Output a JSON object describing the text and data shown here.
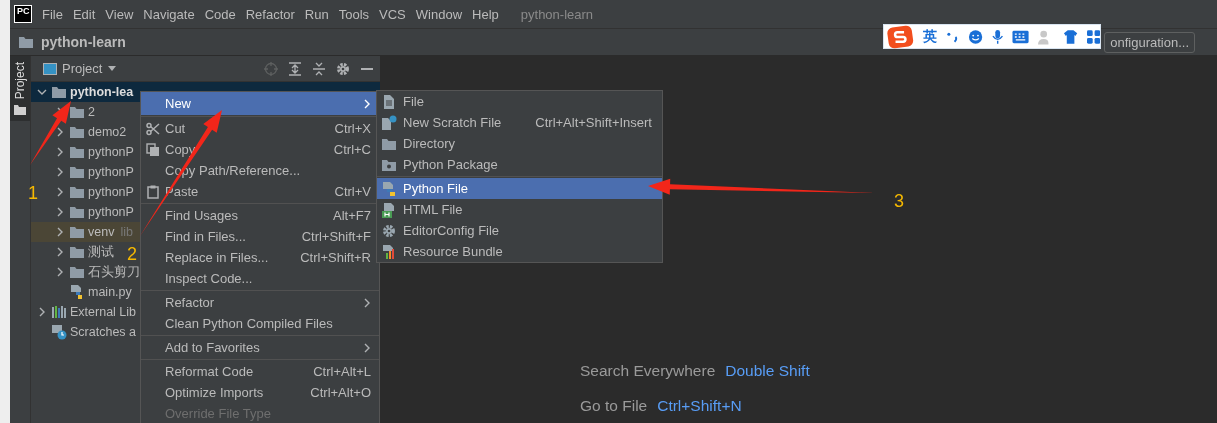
{
  "menu_bar": {
    "logo": "PC",
    "items": [
      "File",
      "Edit",
      "View",
      "Navigate",
      "Code",
      "Refactor",
      "Run",
      "Tools",
      "VCS",
      "Window",
      "Help"
    ],
    "project_title": "python-learn"
  },
  "nav_bar": {
    "project": "python-learn",
    "run_config": "onfiguration..."
  },
  "tool_window_stripe": {
    "label": "Project"
  },
  "project_panel": {
    "title": "Project",
    "tree": [
      {
        "label": "python-lea",
        "kind": "folder",
        "expanded": true,
        "selected": true,
        "highlighted": false,
        "children": [
          {
            "label": "2",
            "kind": "folder",
            "expanded": false,
            "selected": false,
            "highlighted": false
          },
          {
            "label": "demo2",
            "kind": "folder",
            "expanded": false,
            "selected": false,
            "highlighted": false
          },
          {
            "label": "pythonP",
            "kind": "folder",
            "expanded": false,
            "selected": false,
            "highlighted": false
          },
          {
            "label": "pythonP",
            "kind": "folder",
            "expanded": false,
            "selected": false,
            "highlighted": false
          },
          {
            "label": "pythonP",
            "kind": "folder",
            "expanded": false,
            "selected": false,
            "highlighted": false
          },
          {
            "label": "pythonP",
            "kind": "folder",
            "expanded": false,
            "selected": false,
            "highlighted": false
          },
          {
            "label": "venv",
            "hint": "lib",
            "kind": "folder",
            "expanded": false,
            "selected": false,
            "highlighted": true
          },
          {
            "label": "测试",
            "kind": "folder",
            "expanded": false,
            "selected": false,
            "highlighted": false
          },
          {
            "label": "石头剪刀",
            "kind": "folder",
            "expanded": false,
            "selected": false,
            "highlighted": false
          },
          {
            "label": "main.py",
            "kind": "python",
            "selected": false,
            "highlighted": false
          }
        ]
      },
      {
        "label": "External Lib",
        "kind": "library",
        "expanded": false,
        "selected": false,
        "highlighted": false
      },
      {
        "label": "Scratches a",
        "kind": "scratches",
        "selected": false,
        "highlighted": false
      }
    ]
  },
  "context_menu": {
    "groups": [
      [
        {
          "label": "New",
          "kind": "plain",
          "submenu": true,
          "selected": true,
          "disabled": false
        }
      ],
      [
        {
          "label": "Cut",
          "shortcut": "Ctrl+X",
          "kind": "cut",
          "submenu": false,
          "selected": false,
          "disabled": false
        },
        {
          "label": "Copy",
          "shortcut": "Ctrl+C",
          "kind": "copy",
          "submenu": false,
          "selected": false,
          "disabled": false
        },
        {
          "label": "Copy Path/Reference...",
          "kind": "plain",
          "submenu": false,
          "selected": false,
          "disabled": false
        },
        {
          "label": "Paste",
          "shortcut": "Ctrl+V",
          "kind": "paste",
          "submenu": false,
          "selected": false,
          "disabled": false
        }
      ],
      [
        {
          "label": "Find Usages",
          "shortcut": "Alt+F7",
          "kind": "plain",
          "submenu": false,
          "selected": false,
          "disabled": false
        },
        {
          "label": "Find in Files...",
          "shortcut": "Ctrl+Shift+F",
          "kind": "plain",
          "submenu": false,
          "selected": false,
          "disabled": false
        },
        {
          "label": "Replace in Files...",
          "shortcut": "Ctrl+Shift+R",
          "kind": "plain",
          "submenu": false,
          "selected": false,
          "disabled": false
        },
        {
          "label": "Inspect Code...",
          "kind": "plain",
          "submenu": false,
          "selected": false,
          "disabled": false
        }
      ],
      [
        {
          "label": "Refactor",
          "kind": "plain",
          "submenu": true,
          "selected": false,
          "disabled": false
        },
        {
          "label": "Clean Python Compiled Files",
          "kind": "plain",
          "submenu": false,
          "selected": false,
          "disabled": false
        }
      ],
      [
        {
          "label": "Add to Favorites",
          "kind": "plain",
          "submenu": true,
          "selected": false,
          "disabled": false
        }
      ],
      [
        {
          "label": "Reformat Code",
          "shortcut": "Ctrl+Alt+L",
          "kind": "plain",
          "submenu": false,
          "selected": false,
          "disabled": false
        },
        {
          "label": "Optimize Imports",
          "shortcut": "Ctrl+Alt+O",
          "kind": "plain",
          "submenu": false,
          "selected": false,
          "disabled": false
        },
        {
          "label": "Override File Type",
          "kind": "plain",
          "submenu": false,
          "selected": false,
          "disabled": true
        }
      ]
    ]
  },
  "new_submenu": {
    "groups": [
      [
        {
          "label": "File",
          "kind": "file",
          "selected": false
        },
        {
          "label": "New Scratch File",
          "shortcut": "Ctrl+Alt+Shift+Insert",
          "kind": "scratch",
          "selected": false
        },
        {
          "label": "Directory",
          "kind": "folder",
          "selected": false
        },
        {
          "label": "Python Package",
          "kind": "package",
          "selected": false
        }
      ],
      [
        {
          "label": "Python File",
          "kind": "python",
          "selected": true
        },
        {
          "label": "HTML File",
          "kind": "html",
          "selected": false
        },
        {
          "label": "EditorConfig File",
          "kind": "gear",
          "selected": false
        },
        {
          "label": "Resource Bundle",
          "kind": "bundle",
          "selected": false
        }
      ]
    ]
  },
  "editor_hints": [
    {
      "action": "Search Everywhere",
      "shortcut": "Double Shift"
    },
    {
      "action": "Go to File",
      "shortcut": "Ctrl+Shift+N"
    }
  ],
  "annotations": [
    {
      "number": "1"
    },
    {
      "number": "2"
    },
    {
      "number": "3"
    }
  ],
  "ime_toolbar": {
    "mode": "英"
  }
}
